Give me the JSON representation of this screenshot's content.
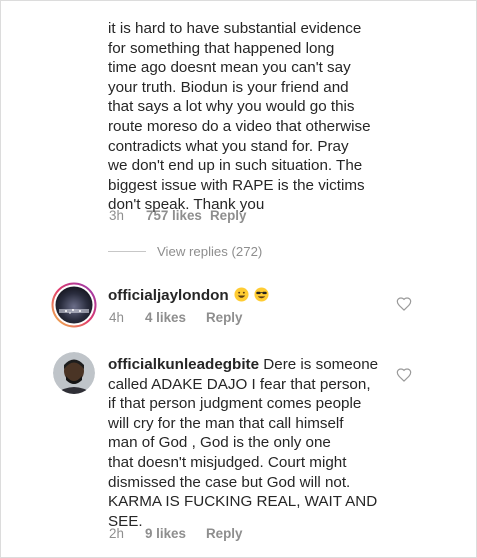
{
  "comment1": {
    "lines": [
      "it is hard to have substantial evidence",
      "for something that happened long",
      "time ago doesnt mean you can't say",
      "your truth. Biodun is your friend and",
      "that says a lot why you would go this",
      "route moreso do a video that otherwise",
      "contradicts what you stand for. Pray",
      "we don't end up in such situation. The",
      "biggest issue with RAPE is the victims",
      "don't speak. Thank you"
    ],
    "time": "3h",
    "likes": "757 likes",
    "reply": "Reply",
    "view_replies": "View replies (272)"
  },
  "comment2": {
    "username": "officialjaylondon",
    "emojis": [
      "grinning-face-emoji",
      "grinning-sunglasses-emoji"
    ],
    "time": "4h",
    "likes": "4 likes",
    "reply": "Reply"
  },
  "comment3": {
    "username": "officialkunleadegbite",
    "lines": [
      " Dere is someone",
      "called ADAKE DAJO I fear that person,",
      "if that person judgment comes people",
      "will cry for the man that call himself",
      "man of God , God is the only one",
      "that doesn't misjudged. Court might",
      "dismissed the case but God will not.",
      "KARMA IS FUCKING REAL, WAIT AND",
      "SEE."
    ],
    "time": "2h",
    "likes": "9 likes",
    "reply": "Reply"
  },
  "colors": {
    "text": "#262626",
    "meta": "#8e8e8e",
    "border": "#dcdcdc"
  },
  "icons": {
    "like": "heart-outline-icon"
  }
}
